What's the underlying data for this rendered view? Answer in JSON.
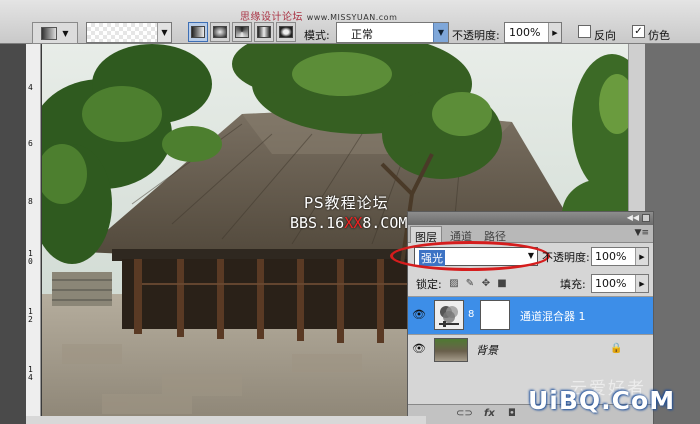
{
  "watermark_top": "思缘设计论坛",
  "watermark_top_url": "www.MISSYUAN.com",
  "options_bar": {
    "mode_label": "模式:",
    "mode_value": "正常",
    "opacity_label": "不透明度:",
    "opacity_value": "100%",
    "reverse_label": "反向",
    "reverse_checked": false,
    "dither_label": "仿色",
    "dither_checked": true,
    "gradient_types": [
      "linear",
      "radial",
      "angle",
      "reflected",
      "diamond"
    ],
    "selected_gradient_type": "linear"
  },
  "ruler": {
    "labels": [
      "4",
      "6",
      "8",
      "1 0",
      "1 2",
      "1 4"
    ]
  },
  "canvas_watermark": {
    "line1": "PS教程论坛",
    "line2_a": "BBS.16",
    "line2_red": "XX",
    "line2_b": "8.COM"
  },
  "layers_panel": {
    "tabs": [
      "图层",
      "通道",
      "路径"
    ],
    "active_tab": "图层",
    "blend_mode": "强光",
    "opacity_label": "不透明度:",
    "opacity_value": "100%",
    "lock_label": "锁定:",
    "fill_label": "填充:",
    "fill_value": "100%",
    "layers": [
      {
        "name": "通道混合器 1",
        "selected": true,
        "visible": true
      },
      {
        "name": "背景",
        "selected": false,
        "visible": true,
        "locked": true
      }
    ],
    "bottom_icons": [
      "link-icon",
      "fx-icon",
      "mask-icon"
    ]
  },
  "site_watermark": "UiBQ.CoM",
  "site_watermark_faint": "云爱好者",
  "colors": {
    "selected_layer": "#3d8ee8",
    "highlight_oval": "#d51d1d"
  }
}
